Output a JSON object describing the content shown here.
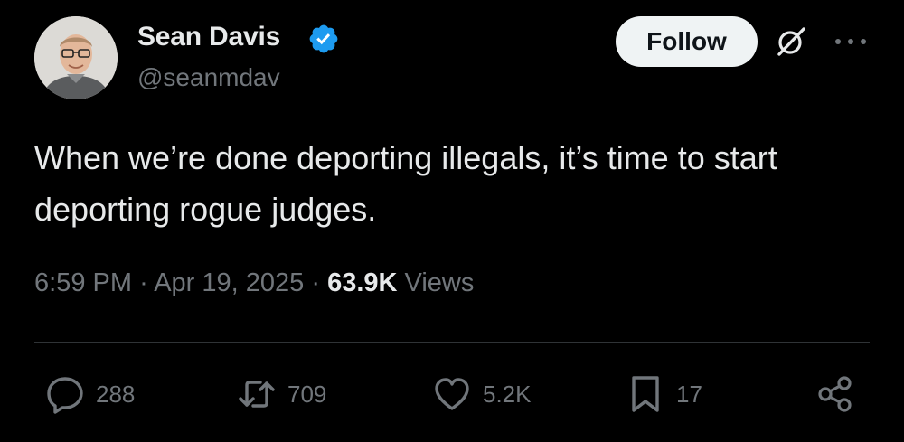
{
  "author": {
    "display_name": "Sean Davis",
    "handle": "@seanmdav",
    "verified_icon": "verified-badge-icon",
    "avatar": "avatar"
  },
  "header": {
    "follow_label": "Follow",
    "grok_icon": "grok-icon",
    "more_icon": "more-icon"
  },
  "tweet": {
    "text": "When we’re done deporting illegals, it’s time to start deporting rogue judges."
  },
  "meta": {
    "time": "6:59 PM",
    "separator": "·",
    "date": "Apr 19, 2025",
    "views_count": "63.9K",
    "views_label": "Views"
  },
  "actions": {
    "replies": "288",
    "reposts": "709",
    "likes": "5.2K",
    "bookmarks": "17"
  },
  "colors": {
    "background": "#000000",
    "primary_text": "#e7e9ea",
    "secondary_text": "#71767b",
    "verified": "#1d9bf0",
    "follow_button_bg": "#eff3f4",
    "divider": "#2f3336"
  }
}
